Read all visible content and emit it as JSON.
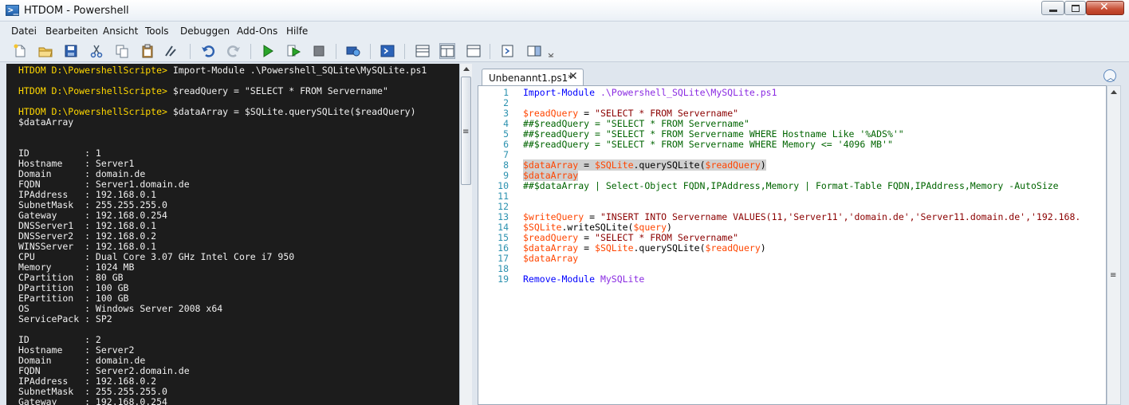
{
  "window": {
    "title": "HTDOM - Powershell"
  },
  "menu": [
    "Datei",
    "Bearbeiten",
    "Ansicht",
    "Tools",
    "Debuggen",
    "Add-Ons",
    "Hilfe"
  ],
  "toolbar": {
    "icons": [
      "new-file-icon",
      "open-folder-icon",
      "save-icon",
      "cut-icon",
      "copy-icon",
      "paste-icon",
      "powershell-clear-icon",
      "undo-icon",
      "redo-icon",
      "run-script-icon",
      "run-selection-icon",
      "stop-icon",
      "remote-powershell-icon",
      "powershell-console-icon",
      "layout-top-icon",
      "layout-right-icon",
      "layout-max-icon",
      "show-script-pane-icon",
      "show-command-pane-icon"
    ]
  },
  "console": {
    "lines": [
      {
        "prompt": "HTDOM D:\\PowershellScripte>",
        "text": " Import-Module .\\Powershell_SQLite\\MySQLite.ps1"
      },
      {
        "prompt": "",
        "text": ""
      },
      {
        "prompt": "HTDOM D:\\PowershellScripte>",
        "text": " $readQuery = \"SELECT * FROM Servername\""
      },
      {
        "prompt": "",
        "text": ""
      },
      {
        "prompt": "HTDOM D:\\PowershellScripte>",
        "text": " $dataArray = $SQLite.querySQLite($readQuery)"
      },
      {
        "prompt": "",
        "text": "$dataArray"
      },
      {
        "prompt": "",
        "text": ""
      },
      {
        "prompt": "",
        "text": ""
      },
      {
        "prompt": "",
        "text": "ID          : 1"
      },
      {
        "prompt": "",
        "text": "Hostname    : Server1"
      },
      {
        "prompt": "",
        "text": "Domain      : domain.de"
      },
      {
        "prompt": "",
        "text": "FQDN        : Server1.domain.de"
      },
      {
        "prompt": "",
        "text": "IPAddress   : 192.168.0.1"
      },
      {
        "prompt": "",
        "text": "SubnetMask  : 255.255.255.0"
      },
      {
        "prompt": "",
        "text": "Gateway     : 192.168.0.254"
      },
      {
        "prompt": "",
        "text": "DNSServer1  : 192.168.0.1"
      },
      {
        "prompt": "",
        "text": "DNSServer2  : 192.168.0.2"
      },
      {
        "prompt": "",
        "text": "WINSServer  : 192.168.0.1"
      },
      {
        "prompt": "",
        "text": "CPU         : Dual Core 3.07 GHz Intel Core i7 950"
      },
      {
        "prompt": "",
        "text": "Memory      : 1024 MB"
      },
      {
        "prompt": "",
        "text": "CPartition  : 80 GB"
      },
      {
        "prompt": "",
        "text": "DPartition  : 100 GB"
      },
      {
        "prompt": "",
        "text": "EPartition  : 100 GB"
      },
      {
        "prompt": "",
        "text": "OS          : Windows Server 2008 x64"
      },
      {
        "prompt": "",
        "text": "ServicePack : SP2"
      },
      {
        "prompt": "",
        "text": ""
      },
      {
        "prompt": "",
        "text": "ID          : 2"
      },
      {
        "prompt": "",
        "text": "Hostname    : Server2"
      },
      {
        "prompt": "",
        "text": "Domain      : domain.de"
      },
      {
        "prompt": "",
        "text": "FQDN        : Server2.domain.de"
      },
      {
        "prompt": "",
        "text": "IPAddress   : 192.168.0.2"
      },
      {
        "prompt": "",
        "text": "SubnetMask  : 255.255.255.0"
      },
      {
        "prompt": "",
        "text": "Gateway     : 192.168.0.254"
      }
    ]
  },
  "editor": {
    "tab_label": "Unbenannt1.ps1*",
    "tab_close": "✕",
    "lines": [
      {
        "n": "1",
        "tokens": [
          {
            "t": "Import-Module",
            "c": "cmd"
          },
          {
            "t": " .\\Powershell_SQLite\\MySQLite.ps1",
            "c": "mod"
          }
        ]
      },
      {
        "n": "2",
        "tokens": []
      },
      {
        "n": "3",
        "tokens": [
          {
            "t": "$readQuery",
            "c": "var"
          },
          {
            "t": " = ",
            "c": "plain"
          },
          {
            "t": "\"SELECT * FROM Servername\"",
            "c": "str"
          }
        ]
      },
      {
        "n": "4",
        "tokens": [
          {
            "t": "##$readQuery = \"SELECT * FROM Servername\"",
            "c": "cmt"
          }
        ]
      },
      {
        "n": "5",
        "tokens": [
          {
            "t": "##$readQuery = \"SELECT * FROM Servername WHERE Hostname Like '%ADS%'\"",
            "c": "cmt"
          }
        ]
      },
      {
        "n": "6",
        "tokens": [
          {
            "t": "##$readQuery = \"SELECT * FROM Servername WHERE Memory <= '4096 MB'\"",
            "c": "cmt"
          }
        ]
      },
      {
        "n": "7",
        "tokens": []
      },
      {
        "n": "8",
        "sel": true,
        "tokens": [
          {
            "t": "$dataArray",
            "c": "var"
          },
          {
            "t": " = ",
            "c": "plain"
          },
          {
            "t": "$SQLite",
            "c": "var"
          },
          {
            "t": ".querySQLite(",
            "c": "plain"
          },
          {
            "t": "$readQuery",
            "c": "var"
          },
          {
            "t": ")",
            "c": "plain"
          }
        ]
      },
      {
        "n": "9",
        "sel": true,
        "tokens": [
          {
            "t": "$dataArray",
            "c": "var"
          }
        ]
      },
      {
        "n": "10",
        "tokens": [
          {
            "t": "##$dataArray | Select-Object FQDN,IPAddress,Memory | Format-Table FQDN,IPAddress,Memory -AutoSize",
            "c": "cmt"
          }
        ]
      },
      {
        "n": "11",
        "tokens": []
      },
      {
        "n": "12",
        "tokens": []
      },
      {
        "n": "13",
        "tokens": [
          {
            "t": "$writeQuery",
            "c": "var"
          },
          {
            "t": " = ",
            "c": "plain"
          },
          {
            "t": "\"INSERT INTO Servername VALUES(11,'Server11','domain.de','Server11.domain.de','192.168.",
            "c": "str"
          }
        ]
      },
      {
        "n": "14",
        "tokens": [
          {
            "t": "$SQLite",
            "c": "var"
          },
          {
            "t": ".writeSQLite(",
            "c": "plain"
          },
          {
            "t": "$query",
            "c": "var"
          },
          {
            "t": ")",
            "c": "plain"
          }
        ]
      },
      {
        "n": "15",
        "tokens": [
          {
            "t": "$readQuery",
            "c": "var"
          },
          {
            "t": " = ",
            "c": "plain"
          },
          {
            "t": "\"SELECT * FROM Servername\"",
            "c": "str"
          }
        ]
      },
      {
        "n": "16",
        "tokens": [
          {
            "t": "$dataArray",
            "c": "var"
          },
          {
            "t": " = ",
            "c": "plain"
          },
          {
            "t": "$SQLite",
            "c": "var"
          },
          {
            "t": ".querySQLite(",
            "c": "plain"
          },
          {
            "t": "$readQuery",
            "c": "var"
          },
          {
            "t": ")",
            "c": "plain"
          }
        ]
      },
      {
        "n": "17",
        "tokens": [
          {
            "t": "$dataArray",
            "c": "var"
          }
        ]
      },
      {
        "n": "18",
        "tokens": []
      },
      {
        "n": "19",
        "tokens": [
          {
            "t": "Remove-Module",
            "c": "cmd"
          },
          {
            "t": " MySQLite",
            "c": "mod"
          }
        ]
      }
    ]
  },
  "colors": {
    "console_bg": "#1c1c1c",
    "console_prompt": "#ffd700",
    "line_numbers": "#2b91af",
    "variable": "#ff4500",
    "string": "#8b0000",
    "comment": "#006400",
    "command": "#0000ff"
  }
}
